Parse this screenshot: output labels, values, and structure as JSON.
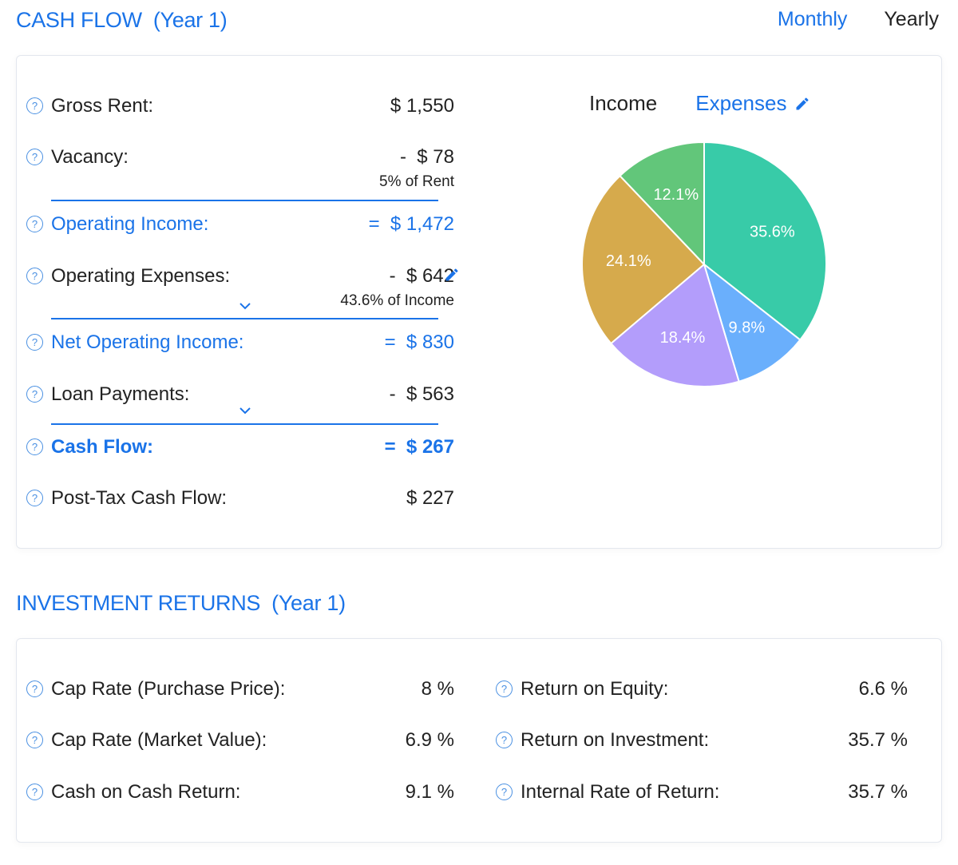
{
  "cash_flow": {
    "title": "CASH FLOW",
    "subtitle": "(Year 1)",
    "period_toggle": {
      "monthly": "Monthly",
      "yearly": "Yearly",
      "selected": "Monthly"
    },
    "help_icon": "?",
    "rows": [
      {
        "label": "Gross Rent:",
        "value": "$ 1,550"
      },
      {
        "label": "Vacancy:",
        "value": "-  $ 78",
        "sub": "5% of Rent"
      },
      {
        "label": "Operating Income:",
        "value": "=  $ 1,472"
      },
      {
        "label": "Operating Expenses:",
        "value": "-  $ 642",
        "sub": "43.6% of Income"
      },
      {
        "label": "Net Operating Income:",
        "value": "=  $ 830"
      },
      {
        "label": "Loan Payments:",
        "value": "-  $ 563"
      },
      {
        "label": "Cash Flow:",
        "value": "=  $ 267"
      },
      {
        "label": "Post-Tax Cash Flow:",
        "value": "$ 227"
      }
    ],
    "chart_tabs": {
      "income": "Income",
      "expenses": "Expenses",
      "selected": "Expenses"
    }
  },
  "chart_data": {
    "type": "pie",
    "title": "Expenses",
    "start_angle": "12 o'clock, clockwise",
    "slices": [
      {
        "label": "35.6%",
        "value": 35.6,
        "color": "#38cba8"
      },
      {
        "label": "9.8%",
        "value": 9.8,
        "color": "#6aaffc"
      },
      {
        "label": "18.4%",
        "value": 18.4,
        "color": "#b39dfb"
      },
      {
        "label": "24.1%",
        "value": 24.1,
        "color": "#d6aa4c"
      },
      {
        "label": "12.1%",
        "value": 12.1,
        "color": "#62c67a"
      }
    ]
  },
  "investment_returns": {
    "title": "INVESTMENT RETURNS",
    "subtitle": "(Year 1)",
    "left": [
      {
        "label": "Cap Rate (Purchase Price):",
        "value": "8 %"
      },
      {
        "label": "Cap Rate (Market Value):",
        "value": "6.9 %"
      },
      {
        "label": "Cash on Cash Return:",
        "value": "9.1 %"
      }
    ],
    "right": [
      {
        "label": "Return on Equity:",
        "value": "6.6 %"
      },
      {
        "label": "Return on Investment:",
        "value": "35.7 %"
      },
      {
        "label": "Internal Rate of Return:",
        "value": "35.7 %"
      }
    ]
  },
  "colors": {
    "accent": "#1a73e8"
  }
}
